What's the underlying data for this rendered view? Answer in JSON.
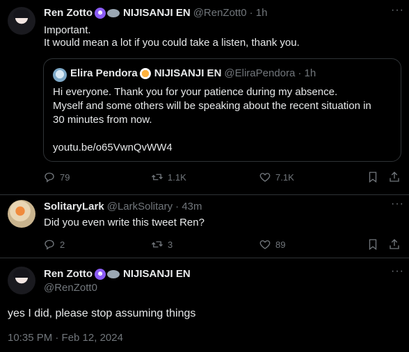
{
  "tweet1": {
    "name": "Ren Zotto",
    "org": "NIJISANJI EN",
    "handle": "@RenZott0",
    "time": "· 1h",
    "line1": "Important.",
    "line2": "It would mean a lot if you could take a listen, thank you.",
    "quote": {
      "name": "Elira Pendora",
      "org": "NIJISANJI EN",
      "handle": "@EliraPendora",
      "time": "· 1h",
      "line1": "Hi everyone. Thank you for your patience during my absence.",
      "line2": "Myself and some others will be speaking about the recent situation in",
      "line3": "30 minutes from now.",
      "link": "youtu.be/o65VwnQvWW4"
    },
    "replies": "79",
    "reposts": "1.1K",
    "likes": "7.1K"
  },
  "tweet2": {
    "name": "SolitaryLark",
    "handle": "@LarkSolitary",
    "time": "· 43m",
    "text": "Did you even write this tweet Ren?",
    "replies": "2",
    "reposts": "3",
    "likes": "89"
  },
  "tweet3": {
    "name": "Ren Zotto",
    "org": "NIJISANJI EN",
    "handle": "@RenZott0",
    "text": "yes I did, please stop assuming things",
    "timestamp": "10:35 PM · Feb 12, 2024"
  },
  "icons": {
    "more": "more-icon",
    "reply": "reply-icon",
    "repost": "repost-icon",
    "like": "like-icon",
    "bookmark": "bookmark-icon",
    "share": "share-icon"
  }
}
